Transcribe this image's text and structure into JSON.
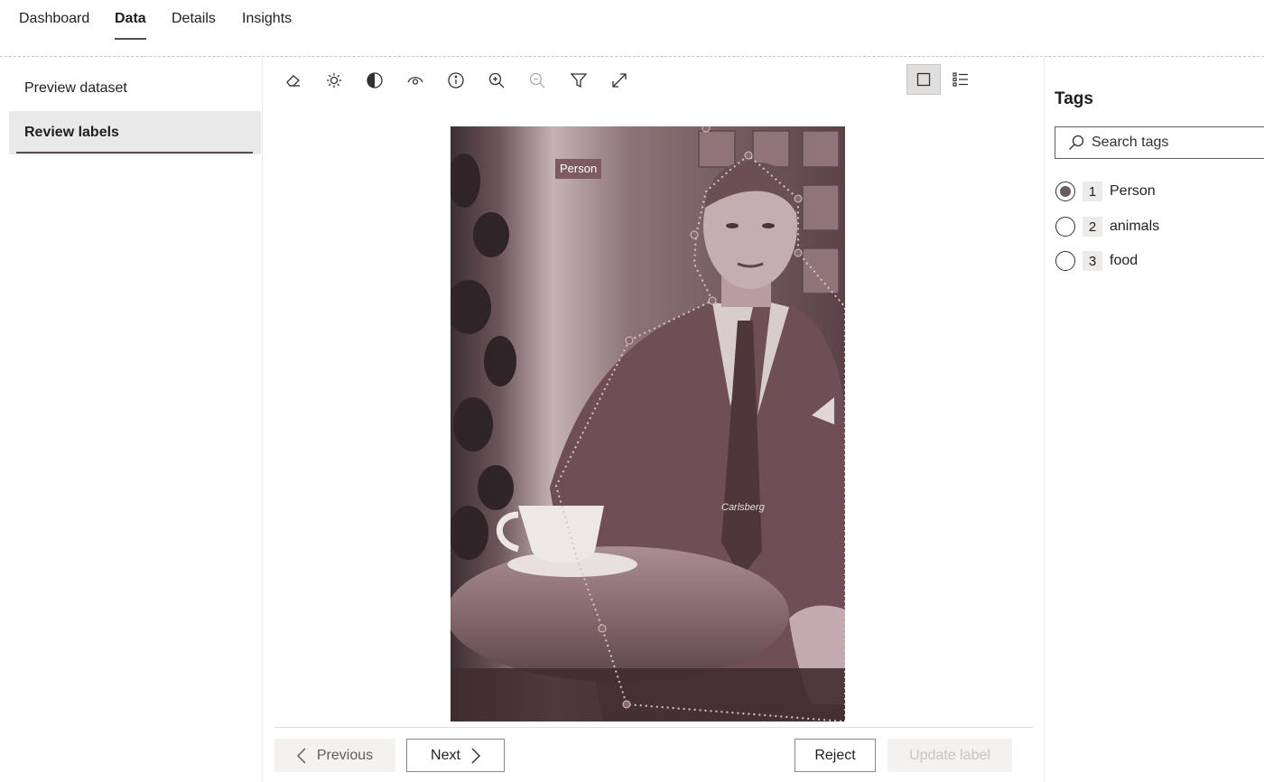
{
  "tabs": [
    {
      "label": "Dashboard"
    },
    {
      "label": "Data"
    },
    {
      "label": "Details"
    },
    {
      "label": "Insights"
    }
  ],
  "active_tab": "Data",
  "sidebar": {
    "items": [
      {
        "label": "Preview dataset"
      },
      {
        "label": "Review labels"
      }
    ],
    "selected": "Review labels"
  },
  "toolbar": {
    "tools": [
      {
        "icon": "eraser-icon"
      },
      {
        "icon": "brightness-icon"
      },
      {
        "icon": "contrast-icon"
      },
      {
        "icon": "eye-icon"
      },
      {
        "icon": "info-icon"
      },
      {
        "icon": "zoom-in-icon"
      },
      {
        "icon": "zoom-out-icon",
        "disabled": true
      },
      {
        "icon": "filter-icon"
      },
      {
        "icon": "expand-icon"
      }
    ],
    "view_modes": [
      {
        "icon": "single-view-icon",
        "active": true
      },
      {
        "icon": "list-view-icon",
        "active": false
      }
    ]
  },
  "canvas": {
    "bbox_label": "Person",
    "watermark": "Carlsberg"
  },
  "buttons": {
    "previous": "Previous",
    "next": "Next",
    "reject": "Reject",
    "update": "Update label"
  },
  "tags_panel": {
    "title": "Tags",
    "search_placeholder": "Search tags",
    "tags": [
      {
        "hotkey": "1",
        "name": "Person",
        "selected": true
      },
      {
        "hotkey": "2",
        "name": "animals",
        "selected": false
      },
      {
        "hotkey": "3",
        "name": "food",
        "selected": false
      }
    ]
  },
  "colors": {
    "accent": "#5a4e54",
    "tint": "#7d5b63",
    "selected_bg": "#e9e9e9"
  }
}
